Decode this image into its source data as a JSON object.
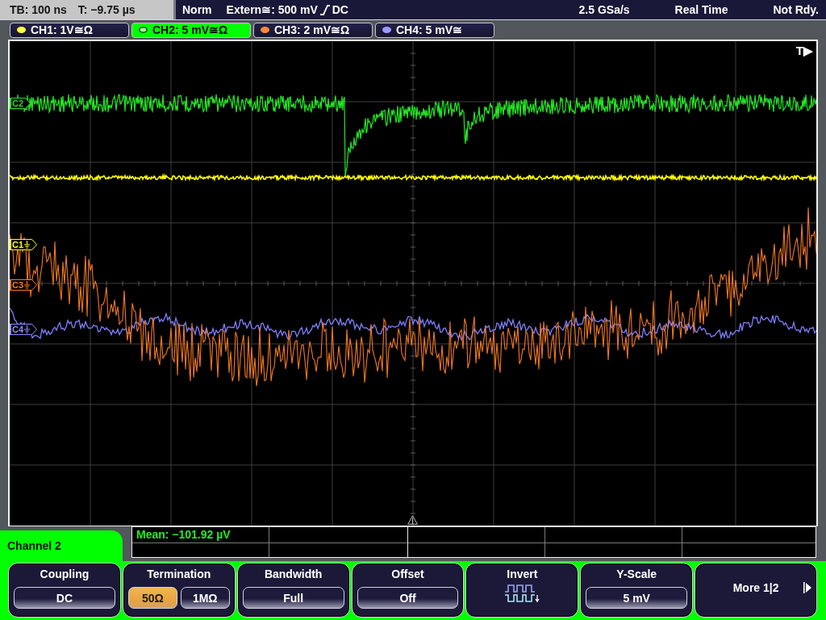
{
  "status_bar": {
    "timebase": "TB: 100 ns",
    "trigger_time": "T: −9.75 µs",
    "trigger_mode": "Norm",
    "trigger_source": "Extern≅: 500 mV",
    "trigger_coupling": "DC",
    "sample_rate": "2.5 GSa/s",
    "acquisition_mode": "Real Time",
    "state": "Not Rdy."
  },
  "channel_tabs": [
    {
      "label": "CH1: 1V≅Ω",
      "color": "#ffff40",
      "selected": false
    },
    {
      "label": "CH2: 5 mV≅Ω",
      "color": "#a8f0a8",
      "selected": true
    },
    {
      "label": "CH3: 2 mV≅Ω",
      "color": "#ff8838",
      "selected": false
    },
    {
      "label": "CH4: 5 mV≅",
      "color": "#9c9cff",
      "selected": false
    }
  ],
  "display": {
    "trigger_label": "T▶",
    "channel_markers": [
      {
        "label": "C2",
        "color": "#22dd22",
        "ground": false
      },
      {
        "label": "C1",
        "color": "#ffff00",
        "ground": true
      },
      {
        "label": "C3",
        "color": "#ff7a1a",
        "ground": true
      },
      {
        "label": "C4",
        "color": "#8c8cff",
        "ground": true
      }
    ]
  },
  "menu": {
    "title": "Channel 2",
    "measurement": "Mean: −101.92 µV",
    "softkeys": [
      {
        "kind": "value",
        "title": "Coupling",
        "value": "DC"
      },
      {
        "kind": "choice",
        "title": "Termination",
        "options": [
          {
            "label": "50Ω",
            "selected": true
          },
          {
            "label": "1MΩ",
            "selected": false
          }
        ]
      },
      {
        "kind": "value",
        "title": "Bandwidth",
        "value": "Full"
      },
      {
        "kind": "value",
        "title": "Offset",
        "value": "Off"
      },
      {
        "kind": "invert",
        "title": "Invert"
      },
      {
        "kind": "value",
        "title": "Y-Scale",
        "value": "5 mV"
      },
      {
        "kind": "more",
        "title": "More 1|2"
      }
    ]
  }
}
